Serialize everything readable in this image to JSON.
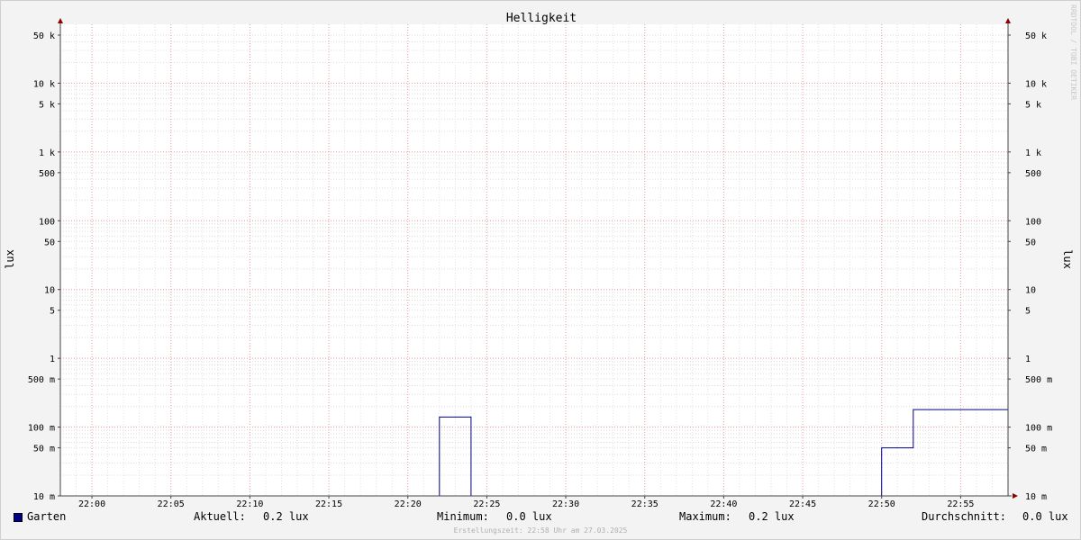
{
  "chart_data": {
    "type": "line",
    "title": "Helligkeit",
    "ylabel": "lux",
    "y_scale": "log",
    "ylim": [
      0.01,
      50000
    ],
    "grid": true,
    "y_ticks": [
      {
        "value": 0.01,
        "label": "10 m"
      },
      {
        "value": 0.05,
        "label": "50 m"
      },
      {
        "value": 0.1,
        "label": "100 m"
      },
      {
        "value": 0.5,
        "label": "500 m"
      },
      {
        "value": 1,
        "label": "1"
      },
      {
        "value": 5,
        "label": "5"
      },
      {
        "value": 10,
        "label": "10"
      },
      {
        "value": 50,
        "label": "50"
      },
      {
        "value": 100,
        "label": "100"
      },
      {
        "value": 500,
        "label": "500"
      },
      {
        "value": 1000,
        "label": "1 k"
      },
      {
        "value": 5000,
        "label": "5 k"
      },
      {
        "value": 10000,
        "label": "10 k"
      },
      {
        "value": 50000,
        "label": "50 k"
      }
    ],
    "x_ticks": [
      "22:00",
      "22:05",
      "22:10",
      "22:15",
      "22:20",
      "22:25",
      "22:30",
      "22:35",
      "22:40",
      "22:45",
      "22:50",
      "22:55"
    ],
    "xlim": [
      "21:58",
      "21:58+60min"
    ],
    "series": [
      {
        "name": "Garten",
        "color": "#00008b",
        "points": [
          {
            "x": "21:58",
            "y": 0.01
          },
          {
            "x": "22:22",
            "y": 0.01
          },
          {
            "x": "22:22",
            "y": 0.14
          },
          {
            "x": "22:24",
            "y": 0.14
          },
          {
            "x": "22:24",
            "y": 0.01
          },
          {
            "x": "22:50",
            "y": 0.01
          },
          {
            "x": "22:50",
            "y": 0.05
          },
          {
            "x": "22:52",
            "y": 0.05
          },
          {
            "x": "22:52",
            "y": 0.18
          },
          {
            "x": "22:58",
            "y": 0.18
          }
        ]
      }
    ]
  },
  "legend": {
    "series_name": "Garten",
    "current_label": "Aktuell:",
    "current_value": "0.2 lux",
    "min_label": "Minimum:",
    "min_value": "0.0 lux",
    "max_label": "Maximum:",
    "max_value": "0.2 lux",
    "avg_label": "Durchschnitt:",
    "avg_value": "0.0 lux"
  },
  "footer": "Erstellungszeit: 22:58 Uhr am 27.03.2025",
  "watermark": "RRDTOOL / TOBI OETIKER"
}
